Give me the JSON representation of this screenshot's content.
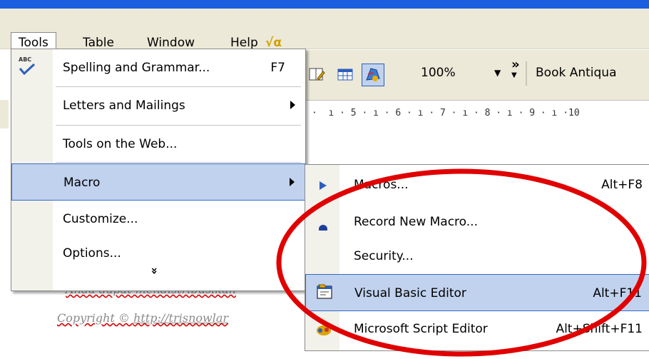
{
  "menubar": {
    "items": [
      {
        "label": "Tools"
      },
      {
        "label": "Table"
      },
      {
        "label": "Window"
      },
      {
        "label": "Help"
      },
      {
        "label": "√α"
      }
    ]
  },
  "toolbar": {
    "zoom": "100%",
    "font": "Book Antiqua",
    "overflow": "»"
  },
  "ruler": {
    "text": "·  ı · 5 · ı · 6 · ı · 7 · ı · 8 · ı · 9 · ı ·10"
  },
  "tools_menu": {
    "spelling_icon_text": "ABC",
    "items": [
      {
        "label": "Spelling and Grammar...",
        "shortcut": "F7"
      },
      {
        "label": "Letters and Mailings",
        "shortcut": ""
      },
      {
        "label": "Tools on the Web...",
        "shortcut": ""
      },
      {
        "label": "Macro",
        "shortcut": ""
      },
      {
        "label": "Customize...",
        "shortcut": ""
      },
      {
        "label": "Options...",
        "shortcut": ""
      }
    ],
    "expand": "»"
  },
  "macro_menu": {
    "items": [
      {
        "label": "Macros...",
        "shortcut": "Alt+F8"
      },
      {
        "label": "Record New Macro...",
        "shortcut": ""
      },
      {
        "label": "Security...",
        "shortcut": ""
      },
      {
        "label": "Visual Basic Editor",
        "shortcut": "Alt+F11"
      },
      {
        "label": "Microsoft Script Editor",
        "shortcut": "Alt+Shift+F11"
      }
    ]
  },
  "document": {
    "line1": "Anda dapat mendistribusikan",
    "line2_prefix": "Copyright © ",
    "line2_link": "http://trisnowlar"
  },
  "colors": {
    "titlebar": "#1b5fe0",
    "menu_bg": "#ece9d8",
    "highlight": "#c1d2ee",
    "annotation": "#e00000"
  }
}
